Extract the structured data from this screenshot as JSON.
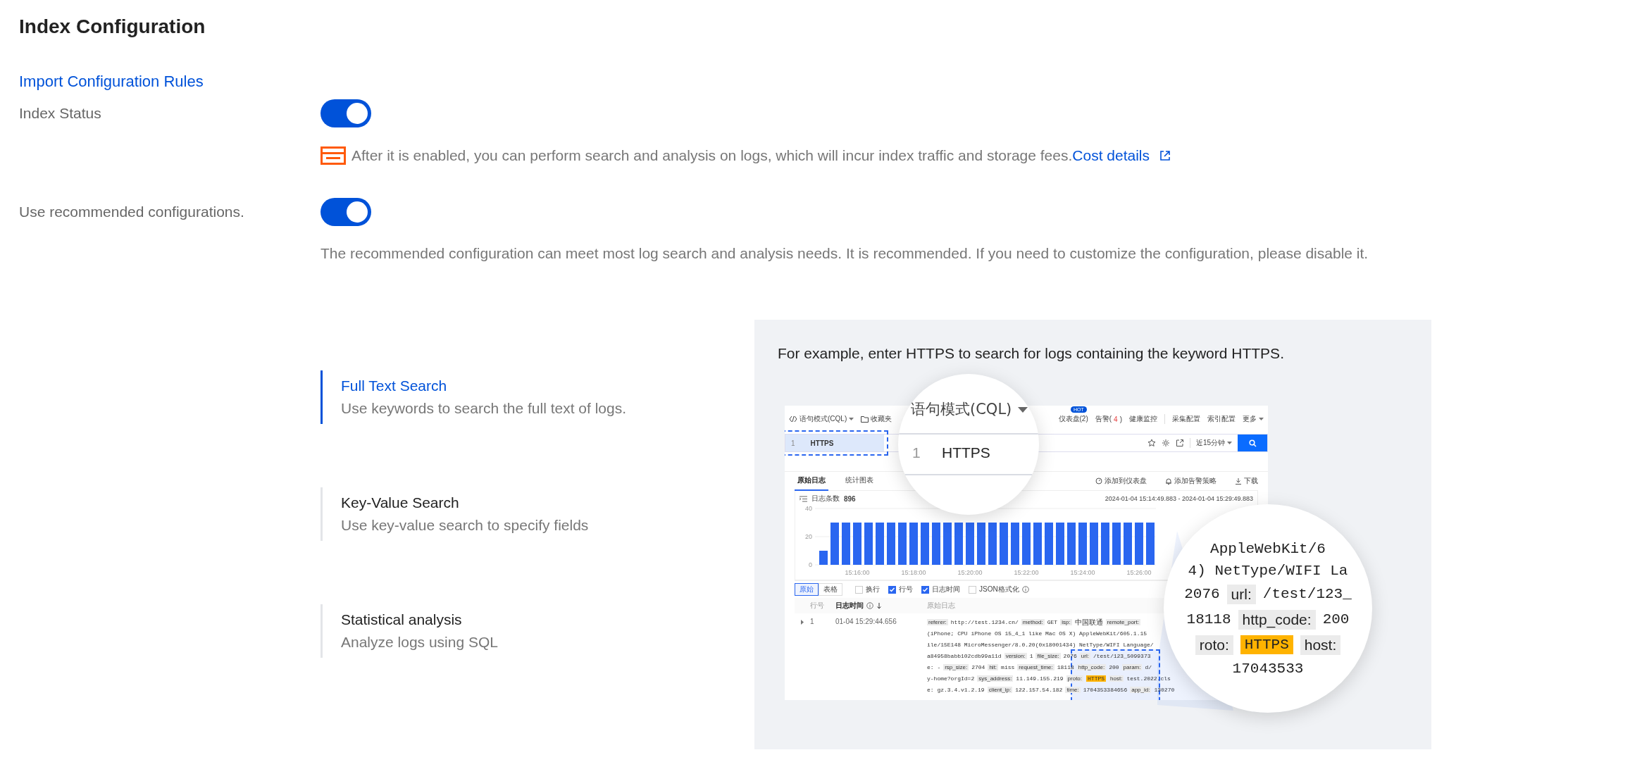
{
  "page": {
    "title": "Index Configuration",
    "import_link": "Import Configuration Rules"
  },
  "settings": [
    {
      "label": "Index Status",
      "on": true,
      "kind": "billing",
      "hint": "After it is enabled, you can perform search and analysis on logs, which will incur index traffic and storage fees.",
      "link": "Cost details"
    },
    {
      "label": "Use recommended configurations.",
      "on": true,
      "kind": "plain",
      "hint": "The recommended configuration can meet most log search and analysis needs. It is recommended. If you need to customize the configuration, please disable it."
    }
  ],
  "features": [
    {
      "title": "Full Text Search",
      "description": "Use keywords to search the full text of logs.",
      "selected": true
    },
    {
      "title": "Key-Value Search",
      "description": "Use key-value search to specify fields",
      "selected": false
    },
    {
      "title": "Statistical analysis",
      "description": "Analyze logs using SQL",
      "selected": false
    }
  ],
  "example": {
    "caption": "For example, enter HTTPS to search for logs containing the keyword HTTPS.",
    "app": {
      "mode": "语句模式(CQL)",
      "favorites": "收藏夹",
      "nav": [
        {
          "kind": "badge",
          "label": "仪表盘(2)",
          "badge": "HOT"
        },
        {
          "kind": "alert",
          "before": "告警(",
          "count": "4",
          "after": ")"
        },
        {
          "kind": "plain",
          "label": "健康监控"
        },
        {
          "kind": "divider"
        },
        {
          "kind": "plain",
          "label": "采集配置"
        },
        {
          "kind": "plain",
          "label": "索引配置"
        },
        {
          "kind": "menu",
          "label": "更多"
        }
      ],
      "query_line": "1",
      "query": "HTTPS",
      "time_range": "近15分钟",
      "tabs": [
        {
          "label": "原始日志",
          "selected": true
        },
        {
          "label": "统计图表",
          "selected": false
        }
      ],
      "actions": [
        {
          "kind": "dashboard",
          "label": "添加到仪表盘"
        },
        {
          "kind": "alarm",
          "label": "添加告警策略"
        },
        {
          "kind": "download",
          "label": "下载"
        }
      ],
      "count_label": "日志条数",
      "count": "896",
      "period": "2024-01-04 15:14:49.883 - 2024-01-04 15:29:49.883",
      "chart_data": {
        "type": "bar",
        "ylim": [
          0,
          40
        ],
        "yticks": [
          0,
          20,
          40
        ],
        "categories": [
          null,
          null,
          null,
          "15:16:00",
          null,
          null,
          null,
          null,
          "15:18:00",
          null,
          null,
          null,
          null,
          "15:20:00",
          null,
          null,
          null,
          null,
          "15:22:00",
          null,
          null,
          null,
          null,
          "15:24:00",
          null,
          null,
          null,
          null,
          "15:26:00",
          null
        ],
        "values": [
          10,
          30,
          30,
          30,
          30,
          30,
          30,
          30,
          30,
          30,
          30,
          30,
          30,
          30,
          30,
          30,
          30,
          30,
          30,
          30,
          30,
          30,
          30,
          30,
          30,
          30,
          30,
          30,
          30,
          30
        ]
      },
      "views": [
        {
          "label": "原始",
          "selected": true
        },
        {
          "label": "表格",
          "selected": false
        }
      ],
      "options": [
        {
          "kind": "plain",
          "label": "换行",
          "checked": false
        },
        {
          "kind": "plain",
          "label": "行号",
          "checked": true
        },
        {
          "kind": "plain",
          "label": "日志时间",
          "checked": true
        },
        {
          "kind": "info",
          "label": "JSON格式化",
          "checked": false
        }
      ],
      "columns": [
        {
          "label": "行号",
          "sorted": false
        },
        {
          "label": "日志时间",
          "sorted": true
        },
        {
          "label": "原始日志",
          "sorted": false
        }
      ],
      "row": {
        "number": "1",
        "time": "01-04 15:29:44.656",
        "lines": [
          [
            {
              "kind": "key",
              "text": "referer:"
            },
            {
              "kind": "value",
              "text": "http://test.1234.cn/"
            },
            {
              "kind": "key",
              "text": "method:"
            },
            {
              "kind": "value",
              "text": "GET"
            },
            {
              "kind": "key",
              "text": "isp:"
            },
            {
              "kind": "cjk",
              "text": "中国联通"
            },
            {
              "kind": "key",
              "text": "remote_port:"
            }
          ],
          [
            {
              "kind": "value",
              "text": "(iPhone; CPU iPhone OS 15_4_1 like Mac OS X) AppleWebKit/605.1.15"
            }
          ],
          [
            {
              "kind": "value",
              "text": "ile/15E148 MicroMessenger/8.0.20(0x18001434) NetType/WIFI Language/"
            }
          ],
          [
            {
              "kind": "value",
              "text": "a84958babb102cdb99a11d"
            },
            {
              "kind": "key",
              "text": "version:"
            },
            {
              "kind": "value",
              "text": "1"
            },
            {
              "kind": "key",
              "text": "file_size:"
            },
            {
              "kind": "value",
              "text": "2076"
            },
            {
              "kind": "key",
              "text": "url:"
            },
            {
              "kind": "value",
              "text": "/test/123_5099373"
            }
          ],
          [
            {
              "kind": "value",
              "text": "e: -"
            },
            {
              "kind": "key",
              "text": "rsp_size:"
            },
            {
              "kind": "value",
              "text": "2704"
            },
            {
              "kind": "key",
              "text": "hit:"
            },
            {
              "kind": "value",
              "text": "miss"
            },
            {
              "kind": "key",
              "text": "request_time:"
            },
            {
              "kind": "value",
              "text": "18118"
            },
            {
              "kind": "key",
              "text": "http_code:"
            },
            {
              "kind": "value",
              "text": "200"
            },
            {
              "kind": "key",
              "text": "param:"
            },
            {
              "kind": "value",
              "text": "d/"
            }
          ],
          [
            {
              "kind": "value",
              "text": "y-home?orgId=2"
            },
            {
              "kind": "key",
              "text": "sys_address:"
            },
            {
              "kind": "value",
              "text": "11.149.155.219"
            },
            {
              "kind": "key",
              "text": "proto:"
            },
            {
              "kind": "match",
              "text": "HTTPS"
            },
            {
              "kind": "key",
              "text": "host:"
            },
            {
              "kind": "value",
              "text": "test.2022.cls"
            }
          ],
          [
            {
              "kind": "value",
              "text": "e: gz.3.4.v1.2.19"
            },
            {
              "kind": "key",
              "text": "client_ip:"
            },
            {
              "kind": "value",
              "text": "122.157.54.182"
            },
            {
              "kind": "key",
              "text": "time:"
            },
            {
              "kind": "value",
              "text": "1704353384656"
            },
            {
              "kind": "key",
              "text": "app_id:"
            },
            {
              "kind": "value",
              "text": "130270"
            }
          ]
        ]
      }
    },
    "zoom_query": {
      "mode": "语句模式(CQL)",
      "line": "1",
      "query": "HTTPS"
    },
    "zoom_log": [
      [
        {
          "kind": "value",
          "text": "AppleWebKit/6"
        }
      ],
      [
        {
          "kind": "value",
          "text": "4) NetType/WIFI La"
        }
      ],
      [
        {
          "kind": "value",
          "text": "2076"
        },
        {
          "kind": "key",
          "text": "url:"
        },
        {
          "kind": "value",
          "text": "/test/123_"
        }
      ],
      [
        {
          "kind": "value",
          "text": "18118"
        },
        {
          "kind": "key",
          "text": "http_code:"
        },
        {
          "kind": "value",
          "text": "200"
        }
      ],
      [
        {
          "kind": "key",
          "text": "roto:"
        },
        {
          "kind": "match",
          "text": "HTTPS"
        },
        {
          "kind": "key",
          "text": "host:"
        }
      ],
      [
        {
          "kind": "value",
          "text": "17043533"
        }
      ]
    ]
  }
}
